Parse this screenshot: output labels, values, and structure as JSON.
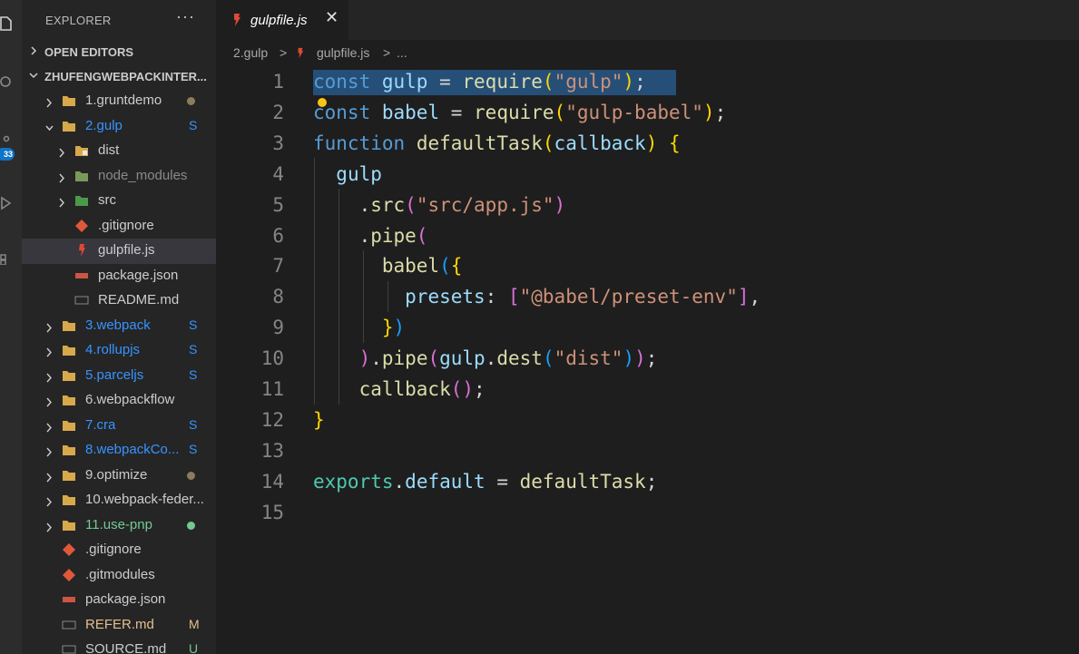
{
  "explorer": {
    "title": "EXPLORER",
    "more": "···",
    "open_editors": "OPEN EDITORS",
    "workspace": "ZHUFENGWEBPACKINTER...",
    "badge": "33"
  },
  "tree": [
    {
      "label": "1.gruntdemo",
      "status": "dot"
    },
    {
      "label": "2.gulp",
      "status": "S"
    },
    {
      "label": "dist",
      "status": ""
    },
    {
      "label": "node_modules",
      "status": ""
    },
    {
      "label": "src",
      "status": ""
    },
    {
      "label": ".gitignore",
      "status": ""
    },
    {
      "label": "gulpfile.js",
      "status": ""
    },
    {
      "label": "package.json",
      "status": ""
    },
    {
      "label": "README.md",
      "status": ""
    },
    {
      "label": "3.webpack",
      "status": "S"
    },
    {
      "label": "4.rollupjs",
      "status": "S"
    },
    {
      "label": "5.parceljs",
      "status": "S"
    },
    {
      "label": "6.webpackflow",
      "status": ""
    },
    {
      "label": "7.cra",
      "status": "S"
    },
    {
      "label": "8.webpackCo...",
      "status": "S"
    },
    {
      "label": "9.optimize",
      "status": "dot"
    },
    {
      "label": "10.webpack-feder...",
      "status": ""
    },
    {
      "label": "11.use-pnp",
      "status": "dot"
    },
    {
      "label": ".gitignore",
      "status": ""
    },
    {
      "label": ".gitmodules",
      "status": ""
    },
    {
      "label": "package.json",
      "status": ""
    },
    {
      "label": "REFER.md",
      "status": "M"
    },
    {
      "label": "SOURCE.md",
      "status": "U"
    }
  ],
  "tab": {
    "label": "gulpfile.js",
    "close": "✕"
  },
  "breadcrumb": [
    "2.gulp",
    ">",
    "gulpfile.js",
    ">",
    "..."
  ],
  "line_numbers": [
    "1",
    "2",
    "3",
    "4",
    "5",
    "6",
    "7",
    "8",
    "9",
    "10",
    "11",
    "12",
    "13",
    "14",
    "15"
  ],
  "code": [
    [
      [
        "k",
        "const"
      ],
      [
        "p",
        " "
      ],
      [
        "v",
        "gulp"
      ],
      [
        "p",
        " = "
      ],
      [
        "f",
        "require"
      ],
      [
        "b1",
        "("
      ],
      [
        "s",
        "\"gulp\""
      ],
      [
        "b1",
        ")"
      ],
      [
        "p",
        ";"
      ]
    ],
    [
      [
        "k",
        "const"
      ],
      [
        "p",
        " "
      ],
      [
        "v",
        "babel"
      ],
      [
        "p",
        " = "
      ],
      [
        "f",
        "require"
      ],
      [
        "b1",
        "("
      ],
      [
        "s",
        "\"gulp-babel\""
      ],
      [
        "b1",
        ")"
      ],
      [
        "p",
        ";"
      ]
    ],
    [
      [
        "k",
        "function"
      ],
      [
        "p",
        " "
      ],
      [
        "f",
        "defaultTask"
      ],
      [
        "b1",
        "("
      ],
      [
        "v",
        "callback"
      ],
      [
        "b1",
        ")"
      ],
      [
        "p",
        " "
      ],
      [
        "b1",
        "{"
      ]
    ],
    [
      [
        "p",
        "  "
      ],
      [
        "v",
        "gulp"
      ]
    ],
    [
      [
        "p",
        "    ."
      ],
      [
        "f",
        "src"
      ],
      [
        "b2",
        "("
      ],
      [
        "s",
        "\"src/app.js\""
      ],
      [
        "b2",
        ")"
      ]
    ],
    [
      [
        "p",
        "    ."
      ],
      [
        "f",
        "pipe"
      ],
      [
        "b2",
        "("
      ]
    ],
    [
      [
        "p",
        "      "
      ],
      [
        "f",
        "babel"
      ],
      [
        "b3",
        "("
      ],
      [
        "b1",
        "{"
      ]
    ],
    [
      [
        "p",
        "        "
      ],
      [
        "v",
        "presets"
      ],
      [
        "p",
        ": "
      ],
      [
        "b2",
        "["
      ],
      [
        "s",
        "\"@babel/preset-env\""
      ],
      [
        "b2",
        "]"
      ],
      [
        "p",
        ","
      ]
    ],
    [
      [
        "p",
        "      "
      ],
      [
        "b1",
        "}"
      ],
      [
        "b3",
        ")"
      ]
    ],
    [
      [
        "p",
        "    "
      ],
      [
        "b2",
        ")"
      ],
      [
        "p",
        "."
      ],
      [
        "f",
        "pipe"
      ],
      [
        "b2",
        "("
      ],
      [
        "v",
        "gulp"
      ],
      [
        "p",
        "."
      ],
      [
        "f",
        "dest"
      ],
      [
        "b3",
        "("
      ],
      [
        "s",
        "\"dist\""
      ],
      [
        "b3",
        ")"
      ],
      [
        "b2",
        ")"
      ],
      [
        "p",
        ";"
      ]
    ],
    [
      [
        "p",
        "    "
      ],
      [
        "f",
        "callback"
      ],
      [
        "b2",
        "("
      ],
      [
        "b2",
        ")"
      ],
      [
        "p",
        ";"
      ]
    ],
    [
      [
        "b1",
        "}"
      ]
    ],
    [],
    [
      [
        "ex",
        "exports"
      ],
      [
        "p",
        "."
      ],
      [
        "v",
        "default"
      ],
      [
        "p",
        " = "
      ],
      [
        "f",
        "defaultTask"
      ],
      [
        "p",
        ";"
      ]
    ],
    []
  ],
  "colors": {
    "keyword": "#569cd6",
    "function": "#dcdcaa",
    "string": "#ce9178",
    "variable": "#9cdcfe",
    "bracket1": "#ffd700",
    "bracket2": "#da70d6",
    "bracket3": "#179fff",
    "selection": "#264f78",
    "status_S": "#3794ff",
    "status_M": "#e2c08d",
    "status_U": "#73c991",
    "git_green": "#73c991"
  },
  "icons": [
    "files-icon",
    "search-icon",
    "source-control-icon",
    "run-icon",
    "extensions-icon",
    "folder-icon",
    "js-file-icon",
    "git-file-icon",
    "json-file-icon",
    "markdown-file-icon"
  ]
}
